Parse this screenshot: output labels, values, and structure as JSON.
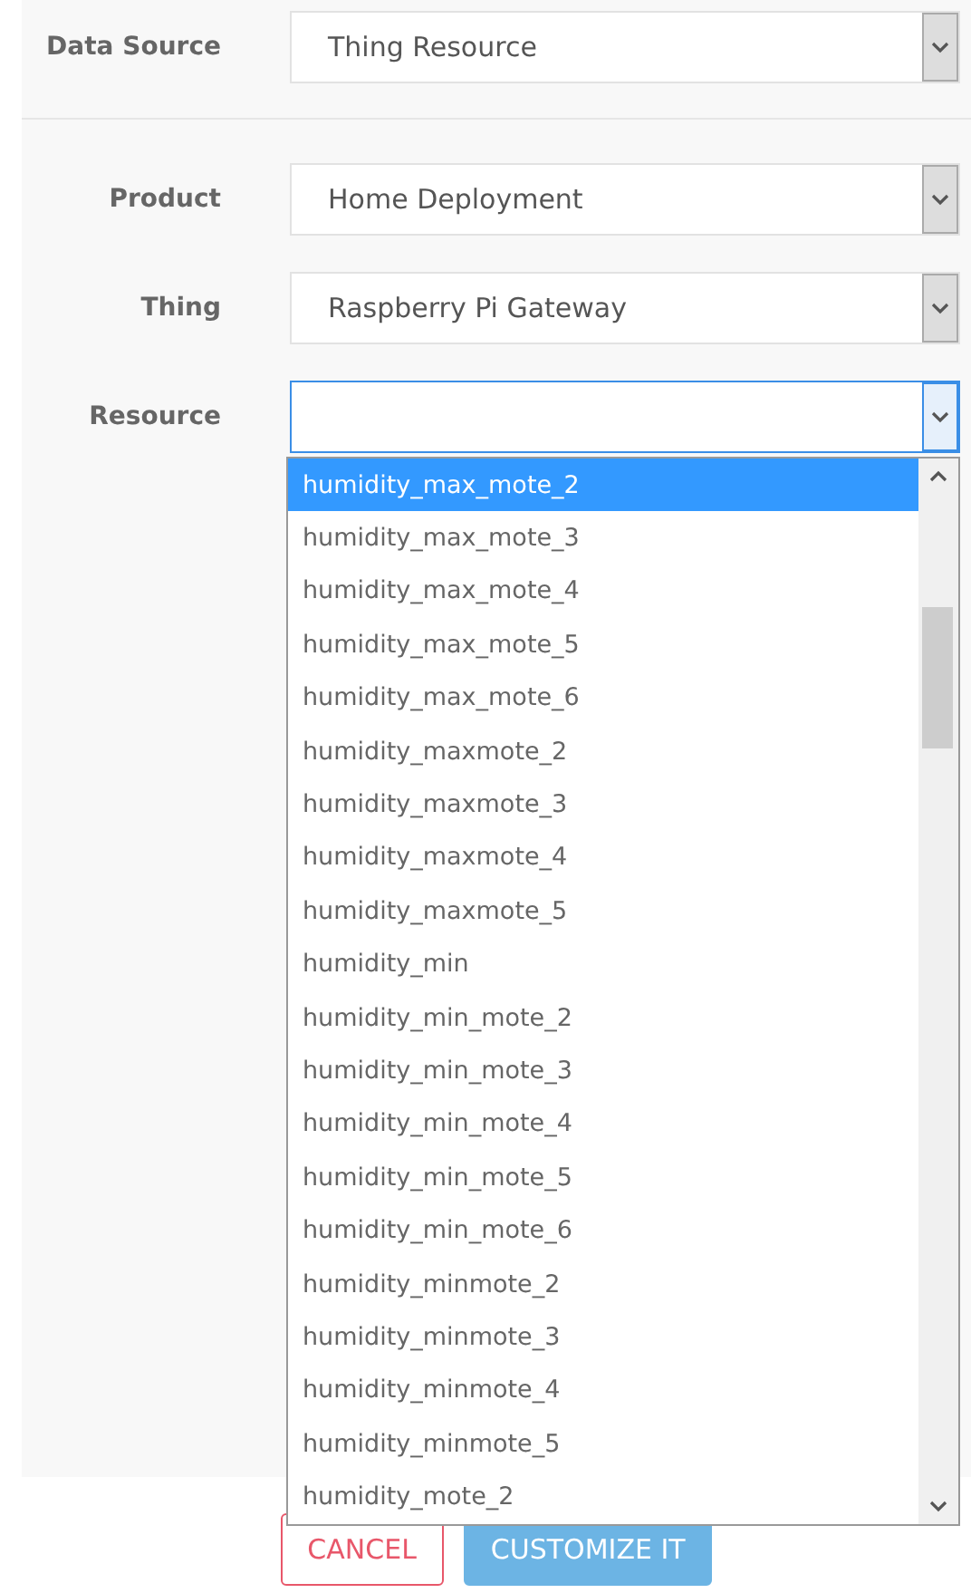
{
  "data_source": {
    "label": "Data Source",
    "value": "Thing Resource"
  },
  "fields": [
    {
      "label": "Product",
      "value": "Home Deployment",
      "open": false
    },
    {
      "label": "Thing",
      "value": "Raspberry Pi Gateway",
      "open": false
    },
    {
      "label": "Resource",
      "open": true
    }
  ],
  "dropdown_options": [
    {
      "label": "humidity_max_mote_2",
      "selected": true
    },
    {
      "label": "humidity_max_mote_3",
      "selected": false
    },
    {
      "label": "humidity_max_mote_4",
      "selected": false
    },
    {
      "label": "humidity_max_mote_5",
      "selected": false
    },
    {
      "label": "humidity_max_mote_6",
      "selected": false
    },
    {
      "label": "humidity_maxmote_2",
      "selected": false
    },
    {
      "label": "humidity_maxmote_3",
      "selected": false
    },
    {
      "label": "humidity_maxmote_4",
      "selected": false
    },
    {
      "label": "humidity_maxmote_5",
      "selected": false
    },
    {
      "label": "humidity_min",
      "selected": false
    },
    {
      "label": "humidity_min_mote_2",
      "selected": false
    },
    {
      "label": "humidity_min_mote_3",
      "selected": false
    },
    {
      "label": "humidity_min_mote_4",
      "selected": false
    },
    {
      "label": "humidity_min_mote_5",
      "selected": false
    },
    {
      "label": "humidity_min_mote_6",
      "selected": false
    },
    {
      "label": "humidity_minmote_2",
      "selected": false
    },
    {
      "label": "humidity_minmote_3",
      "selected": false
    },
    {
      "label": "humidity_minmote_4",
      "selected": false
    },
    {
      "label": "humidity_minmote_5",
      "selected": false
    },
    {
      "label": "humidity_mote_2",
      "selected": false
    }
  ],
  "buttons": [
    {
      "label": "CANCEL",
      "kind": "outline"
    },
    {
      "label": "CUSTOMIZE IT",
      "kind": "primary"
    }
  ]
}
